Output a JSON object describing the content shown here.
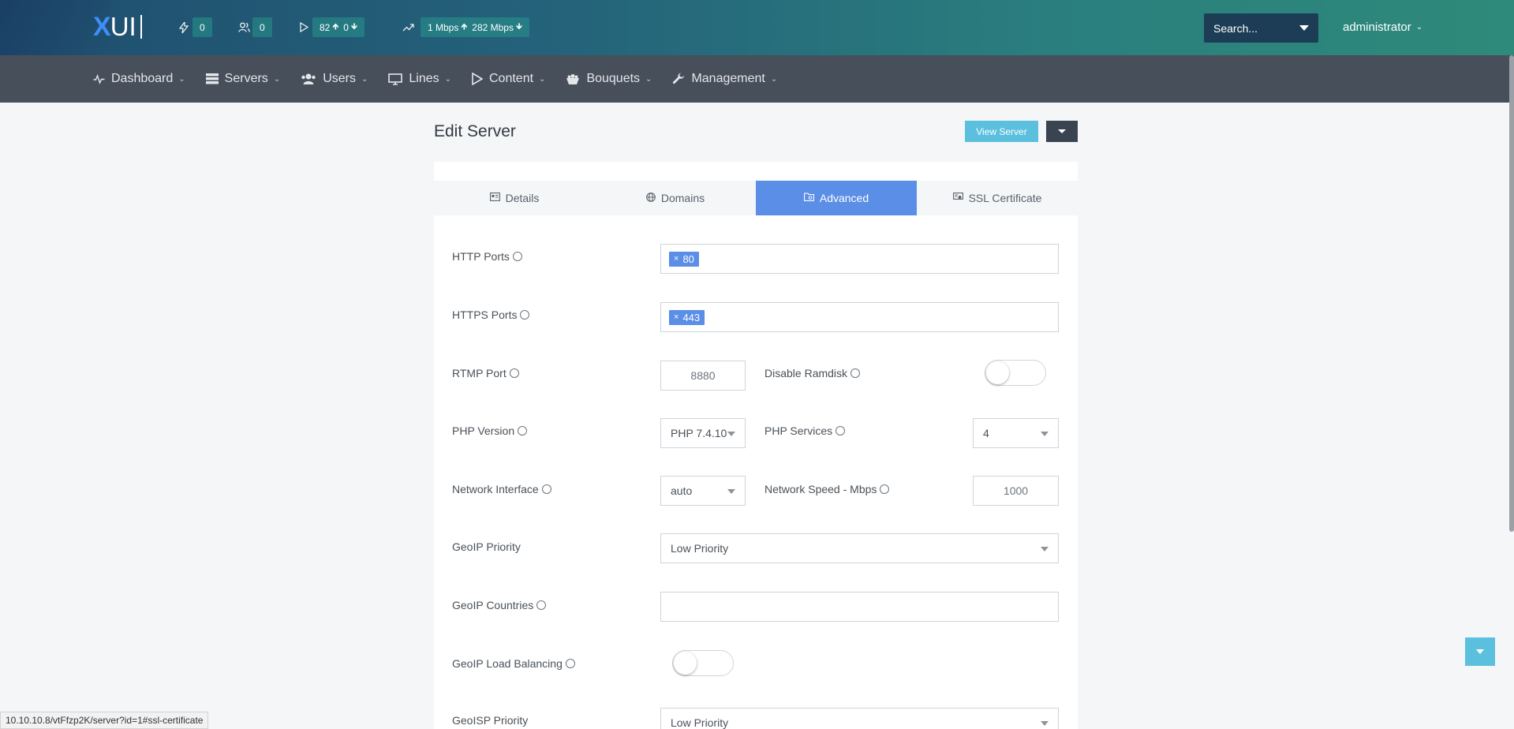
{
  "topbar": {
    "logo": {
      "x": "X",
      "rest": "UI"
    },
    "stats": [
      {
        "icon": "bolt-icon",
        "value": "0"
      },
      {
        "icon": "users-icon",
        "value": "0"
      },
      {
        "icon": "play-icon",
        "value_up": "82",
        "value_down": "0"
      },
      {
        "icon": "trending-up-icon",
        "value_up": "1 Mbps",
        "value_down": "282 Mbps"
      }
    ],
    "search_placeholder": "Search...",
    "user": "administrator"
  },
  "nav": [
    {
      "label": "Dashboard",
      "icon": "activity-icon"
    },
    {
      "label": "Servers",
      "icon": "server-icon"
    },
    {
      "label": "Users",
      "icon": "users-icon"
    },
    {
      "label": "Lines",
      "icon": "monitor-icon"
    },
    {
      "label": "Content",
      "icon": "play-icon"
    },
    {
      "label": "Bouquets",
      "icon": "bouquet-icon"
    },
    {
      "label": "Management",
      "icon": "wrench-icon"
    }
  ],
  "page": {
    "title": "Edit Server",
    "view_button": "View Server"
  },
  "tabs": [
    {
      "label": "Details",
      "icon": "id-card-icon",
      "active": false
    },
    {
      "label": "Domains",
      "icon": "globe-icon",
      "active": false
    },
    {
      "label": "Advanced",
      "icon": "folder-icon",
      "active": true
    },
    {
      "label": "SSL Certificate",
      "icon": "certificate-icon",
      "active": false
    }
  ],
  "form": {
    "http_ports": {
      "label": "HTTP Ports",
      "tags": [
        "80"
      ]
    },
    "https_ports": {
      "label": "HTTPS Ports",
      "tags": [
        "443"
      ]
    },
    "rtmp_port": {
      "label": "RTMP Port",
      "value": "8880"
    },
    "disable_ramdisk": {
      "label": "Disable Ramdisk",
      "checked": false
    },
    "php_version": {
      "label": "PHP Version",
      "value": "PHP 7.4.10"
    },
    "php_services": {
      "label": "PHP Services",
      "value": "4"
    },
    "network_interface": {
      "label": "Network Interface",
      "value": "auto"
    },
    "network_speed": {
      "label": "Network Speed - Mbps",
      "value": "1000"
    },
    "geoip_priority": {
      "label": "GeoIP Priority",
      "value": "Low Priority"
    },
    "geoip_countries": {
      "label": "GeoIP Countries",
      "value": ""
    },
    "geoip_load_balancing": {
      "label": "GeoIP Load Balancing",
      "checked": false
    },
    "geoisp_priority": {
      "label": "GeoISP Priority",
      "value": "Low Priority"
    }
  },
  "status_url": "10.10.10.8/vtFfzp2K/server?id=1#ssl-certificate"
}
